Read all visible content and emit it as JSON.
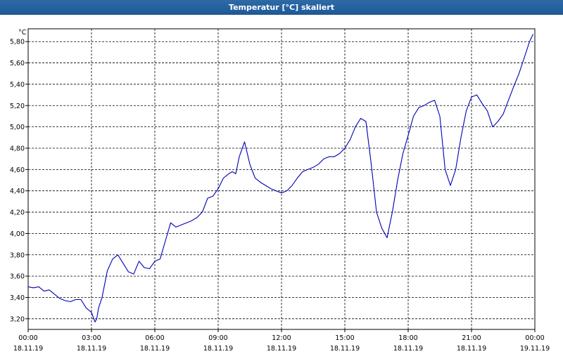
{
  "window": {
    "title": "Temperatur [°C] skaliert"
  },
  "chart_data": {
    "type": "line",
    "title": "Temperatur [°C] skaliert",
    "ylabel": "°C",
    "xlabel": "",
    "ylim": [
      3.1,
      5.92
    ],
    "xlim": [
      0,
      24
    ],
    "grid": true,
    "line_color": "#0000b4",
    "y_ticks": [
      "3,20",
      "3,40",
      "3,60",
      "3,80",
      "4,00",
      "4,20",
      "4,40",
      "4,60",
      "4,80",
      "5,00",
      "5,20",
      "5,40",
      "5,60",
      "5,80"
    ],
    "x_ticks": [
      {
        "time": "00:00",
        "date": "18.11.19"
      },
      {
        "time": "03:00",
        "date": "18.11.19"
      },
      {
        "time": "06:00",
        "date": "18.11.19"
      },
      {
        "time": "09:00",
        "date": "18.11.19"
      },
      {
        "time": "12:00",
        "date": "18.11.19"
      },
      {
        "time": "15:00",
        "date": "18.11.19"
      },
      {
        "time": "18:00",
        "date": "18.11.19"
      },
      {
        "time": "21:00",
        "date": "18.11.19"
      },
      {
        "time": "00:00",
        "date": "19.11.19"
      }
    ],
    "series": [
      {
        "x": [
          "00:00",
          "00:15",
          "00:30",
          "00:45",
          "01:00",
          "01:15",
          "01:30",
          "01:45",
          "02:00",
          "02:15",
          "02:30",
          "02:45",
          "03:00",
          "03:10",
          "03:15",
          "03:20",
          "03:30",
          "03:45",
          "04:00",
          "04:15",
          "04:30",
          "04:45",
          "05:00",
          "05:15",
          "05:30",
          "05:45",
          "06:00",
          "06:15",
          "06:30",
          "06:45",
          "07:00",
          "07:15",
          "07:30",
          "07:45",
          "08:00",
          "08:15",
          "08:30",
          "08:45",
          "09:00",
          "09:15",
          "09:30",
          "09:40",
          "09:45",
          "09:50",
          "10:00",
          "10:15",
          "10:30",
          "10:45",
          "11:00",
          "11:15",
          "11:30",
          "11:45",
          "12:00",
          "12:15",
          "12:30",
          "12:45",
          "13:00",
          "13:15",
          "13:30",
          "13:45",
          "14:00",
          "14:15",
          "14:30",
          "14:45",
          "15:00",
          "15:15",
          "15:30",
          "15:45",
          "16:00",
          "16:15",
          "16:30",
          "16:45",
          "17:00",
          "17:15",
          "17:30",
          "17:45",
          "18:00",
          "18:15",
          "18:30",
          "18:45",
          "19:00",
          "19:15",
          "19:30",
          "19:45",
          "20:00",
          "20:15",
          "20:30",
          "20:45",
          "21:00",
          "21:15",
          "21:30",
          "21:45",
          "22:00",
          "22:15",
          "22:30",
          "22:45",
          "23:00",
          "23:15",
          "23:30",
          "23:45",
          "23:55"
        ],
        "y": [
          3.5,
          3.49,
          3.5,
          3.46,
          3.47,
          3.43,
          3.39,
          3.37,
          3.36,
          3.38,
          3.38,
          3.3,
          3.26,
          3.17,
          3.2,
          3.3,
          3.4,
          3.65,
          3.76,
          3.8,
          3.72,
          3.64,
          3.62,
          3.74,
          3.68,
          3.67,
          3.74,
          3.76,
          3.93,
          4.1,
          4.06,
          4.08,
          4.1,
          4.12,
          4.15,
          4.2,
          4.33,
          4.35,
          4.42,
          4.52,
          4.56,
          4.58,
          4.57,
          4.56,
          4.72,
          4.86,
          4.65,
          4.52,
          4.48,
          4.45,
          4.42,
          4.4,
          4.38,
          4.4,
          4.45,
          4.52,
          4.58,
          4.6,
          4.62,
          4.65,
          4.7,
          4.72,
          4.72,
          4.75,
          4.8,
          4.88,
          5.0,
          5.08,
          5.05,
          4.65,
          4.2,
          4.05,
          3.96,
          4.2,
          4.5,
          4.75,
          4.92,
          5.1,
          5.18,
          5.2,
          5.23,
          5.25,
          5.1,
          4.6,
          4.45,
          4.6,
          4.9,
          5.15,
          5.28,
          5.3,
          5.22,
          5.15,
          5.0,
          5.05,
          5.12,
          5.25,
          5.38,
          5.5,
          5.65,
          5.8,
          5.87
        ]
      }
    ]
  }
}
